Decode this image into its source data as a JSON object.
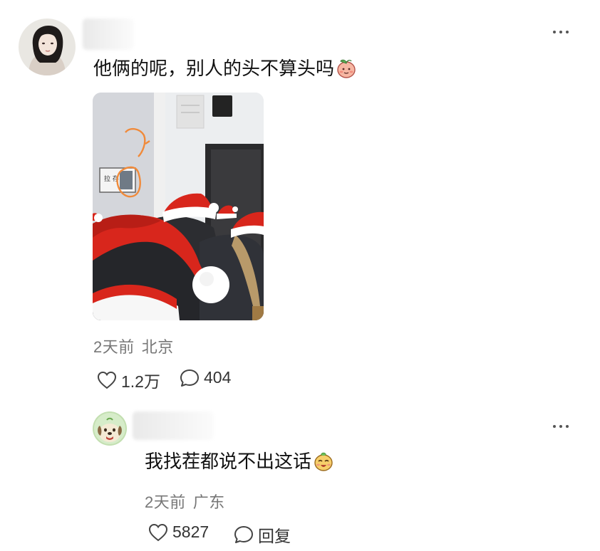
{
  "comment": {
    "text": "他俩的呢，别人的头不算头吗",
    "emoji_icon": "peach-face-emoji-icon",
    "time": "2天前",
    "location": "北京",
    "likes": "1.2万",
    "replies": "404"
  },
  "reply": {
    "text": "我找茬都说不出这话",
    "emoji_icon": "smiling-face-emoji-icon",
    "time": "2天前",
    "location": "广东",
    "likes": "5827",
    "reply_label": "回复"
  },
  "photo": {
    "wall_sign_text": "拉 存"
  },
  "colors": {
    "santa_red": "#d8261c",
    "icon_gray": "#444444",
    "meta_gray": "#777777",
    "annotation_orange": "#f08a3a"
  }
}
